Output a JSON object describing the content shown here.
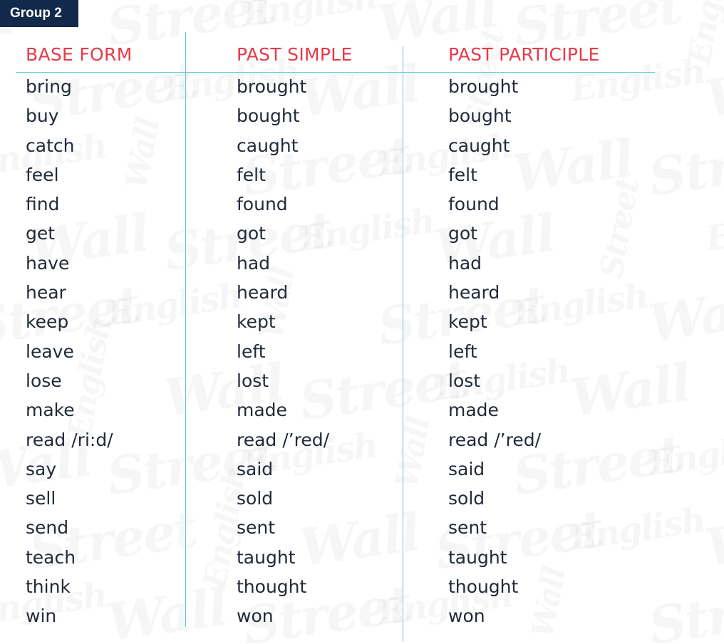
{
  "group_label": "Group 2",
  "columns": [
    "BASE FORM",
    "PAST SIMPLE",
    "PAST PARTICIPLE"
  ],
  "rows": [
    [
      "bring",
      "brought",
      "brought"
    ],
    [
      "buy",
      "bought",
      "bought"
    ],
    [
      "catch",
      "caught",
      "caught"
    ],
    [
      "feel",
      "felt",
      "felt"
    ],
    [
      "find",
      "found",
      "found"
    ],
    [
      "get",
      "got",
      "got"
    ],
    [
      "have",
      "had",
      "had"
    ],
    [
      "hear",
      "heard",
      "heard"
    ],
    [
      "keep",
      "kept",
      "kept"
    ],
    [
      "leave",
      "left",
      "left"
    ],
    [
      "lose",
      "lost",
      "lost"
    ],
    [
      "make",
      "made",
      "made"
    ],
    [
      "read /ri:d/",
      "read /’red/",
      "read /’red/"
    ],
    [
      "say",
      "said",
      "said"
    ],
    [
      "sell",
      "sold",
      "sold"
    ],
    [
      "send",
      "sent",
      "sent"
    ],
    [
      "teach",
      "taught",
      "taught"
    ],
    [
      "think",
      "thought",
      "thought"
    ],
    [
      "win",
      "won",
      "won"
    ]
  ],
  "watermark_words": [
    "Wall",
    "Street",
    "English"
  ],
  "colors": {
    "header_text": "#e63b4a",
    "rule_lines": "#5bc6d8",
    "label_background": "#13294b",
    "body_text": "#222a3a"
  }
}
